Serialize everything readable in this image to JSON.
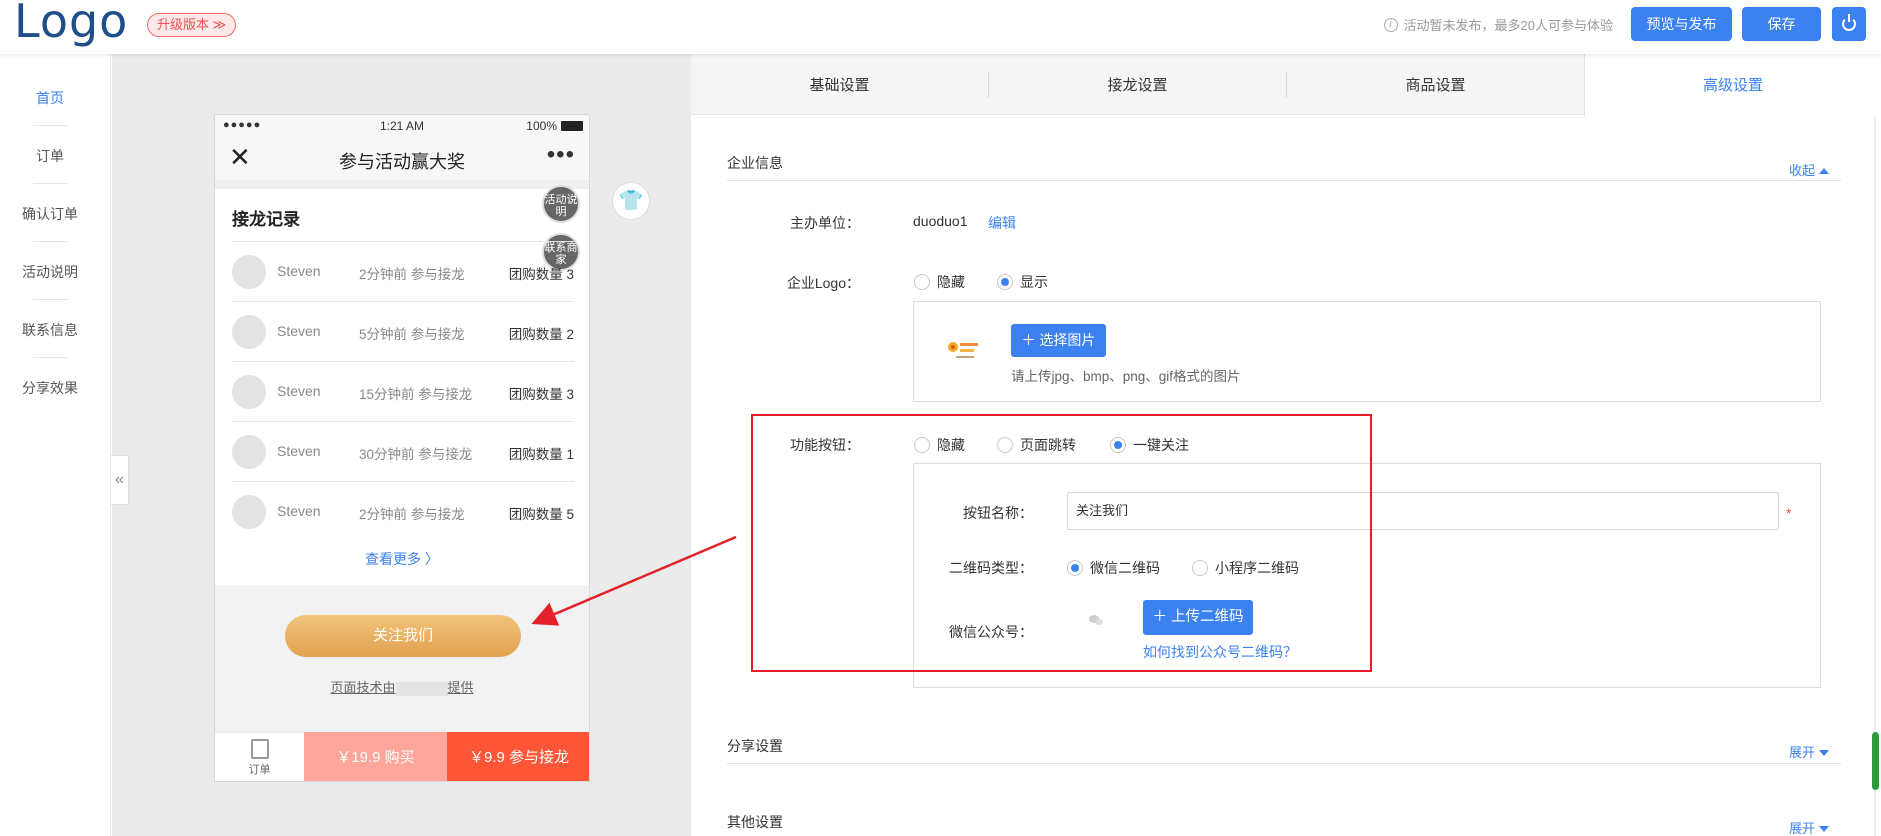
{
  "header": {
    "logo": "Logo",
    "upgrade": "升级版本 ≫",
    "notice": "活动暂未发布，最多20人可参与体验",
    "preview_btn": "预览与发布",
    "save_btn": "保存"
  },
  "leftnav": {
    "items": [
      "首页",
      "订单",
      "确认订单",
      "活动说明",
      "联系信息",
      "分享效果"
    ],
    "collapse": "«"
  },
  "phone": {
    "status": {
      "dots": "●●●●●",
      "time": "1:21 AM",
      "battery": "100%"
    },
    "title": "参与活动赢大奖",
    "close": "✕",
    "more": "•••",
    "record_head": "接龙记录",
    "float_activity": "活动说明",
    "float_contact": "联系商家",
    "records": [
      {
        "name": "Steven",
        "when": "2分钟前 参与接龙",
        "qty": "团购数量 3"
      },
      {
        "name": "Steven",
        "when": "5分钟前 参与接龙",
        "qty": "团购数量 2"
      },
      {
        "name": "Steven",
        "when": "15分钟前 参与接龙",
        "qty": "团购数量 3"
      },
      {
        "name": "Steven",
        "when": "30分钟前 参与接龙",
        "qty": "团购数量 1"
      },
      {
        "name": "Steven",
        "when": "2分钟前 参与接龙",
        "qty": "团购数量 5"
      }
    ],
    "see_more": "查看更多 〉",
    "follow_btn": "关注我们",
    "tech_prefix": "页面技术由",
    "tech_suffix": "提供",
    "bottom": {
      "order": "订单",
      "buy": "￥19.9 购买",
      "join": "￥9.9 参与接龙"
    }
  },
  "tabs": [
    "基础设置",
    "接龙设置",
    "商品设置",
    "高级设置"
  ],
  "company": {
    "section_title": "企业信息",
    "collapse": "收起",
    "host_label": "主办单位：",
    "host_value": "duoduo1",
    "edit": "编辑",
    "logo_label": "企业Logo：",
    "logo_hide": "隐藏",
    "logo_show": "显示",
    "choose_image": "选择图片",
    "image_hint": "请上传jpg、bmp、png、gif格式的图片",
    "func_label": "功能按钮：",
    "func_hide": "隐藏",
    "func_jump": "页面跳转",
    "func_follow": "一键关注",
    "btn_name_label": "按钮名称：",
    "btn_name_value": "关注我们",
    "required": "*",
    "qr_type_label": "二维码类型：",
    "qr_wechat": "微信二维码",
    "qr_mini": "小程序二维码",
    "wechat_label": "微信公众号：",
    "upload_qr": "上传二维码",
    "find_qr": "如何找到公众号二维码？"
  },
  "share": {
    "section_title": "分享设置",
    "expand": "展开"
  },
  "other": {
    "section_title": "其他设置",
    "expand": "展开"
  },
  "colors": {
    "accent": "#3b82f0",
    "highlight": "#e4202a",
    "join": "#ff5637",
    "buy": "#ffa69c"
  }
}
